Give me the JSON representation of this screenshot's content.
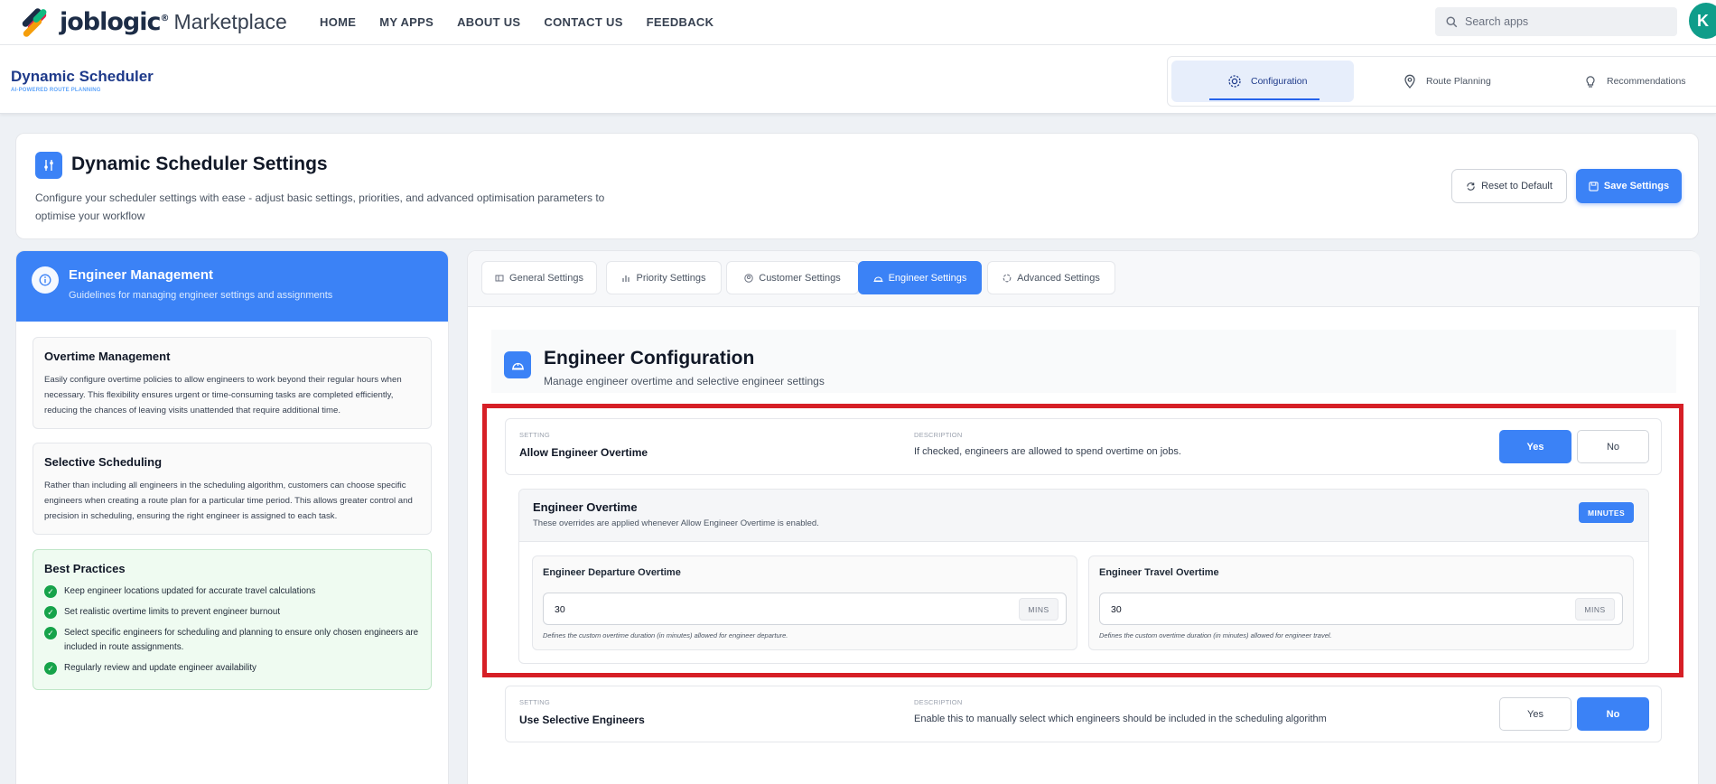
{
  "topnav": {
    "brand": "joblogic",
    "brand_mark": "®",
    "product": "Marketplace",
    "links": [
      "HOME",
      "MY APPS",
      "ABOUT US",
      "CONTACT US",
      "FEEDBACK"
    ],
    "search_placeholder": "Search apps",
    "avatar_initial": "K"
  },
  "app": {
    "title": "Dynamic Scheduler",
    "subtitle": "AI-POWERED ROUTE PLANNING",
    "tabs": [
      {
        "label": "Configuration",
        "icon": "gear-icon",
        "active": true
      },
      {
        "label": "Route Planning",
        "icon": "map-pin-icon",
        "active": false
      },
      {
        "label": "Recommendations",
        "icon": "lightbulb-icon",
        "active": false
      }
    ]
  },
  "settings_header": {
    "title": "Dynamic Scheduler Settings",
    "description": "Configure your scheduler settings with ease - adjust basic settings, priorities, and advanced optimisation parameters to optimise your workflow",
    "reset_label": "Reset to Default",
    "save_label": "Save Settings"
  },
  "left_panel": {
    "title": "Engineer Management",
    "subtitle": "Guidelines for managing engineer settings and assignments",
    "cards": [
      {
        "title": "Overtime Management",
        "text": "Easily configure overtime policies to allow engineers to work beyond their regular hours when necessary. This flexibility ensures urgent or time-consuming tasks are completed efficiently, reducing the chances of leaving visits unattended that require additional time."
      },
      {
        "title": "Selective Scheduling",
        "text": "Rather than including all engineers in the scheduling algorithm, customers can choose specific engineers when creating a route plan for a particular time period. This allows greater control and precision in scheduling, ensuring the right engineer is assigned to each task."
      }
    ],
    "best_practices": {
      "title": "Best Practices",
      "items": [
        "Keep engineer locations updated for accurate travel calculations",
        "Set realistic overtime limits to prevent engineer burnout",
        "Select specific engineers for scheduling and planning to ensure only chosen engineers are included in route assignments.",
        "Regularly review and update engineer availability"
      ]
    }
  },
  "tabs": [
    {
      "label": "General Settings",
      "active": false
    },
    {
      "label": "Priority Settings",
      "active": false
    },
    {
      "label": "Customer Settings",
      "active": false
    },
    {
      "label": "Engineer Settings",
      "active": true
    },
    {
      "label": "Advanced Settings",
      "active": false
    }
  ],
  "engineer_config": {
    "title": "Engineer Configuration",
    "subtitle": "Manage engineer overtime and selective engineer settings",
    "setting_label": "SETTING",
    "description_label": "DESCRIPTION",
    "yes_label": "Yes",
    "no_label": "No",
    "allow_overtime": {
      "name": "Allow Engineer Overtime",
      "description": "If checked, engineers are allowed to spend overtime on jobs.",
      "value": "Yes"
    },
    "overtime": {
      "title": "Engineer Overtime",
      "subtitle": "These overrides are applied whenever Allow Engineer Overtime is enabled.",
      "badge": "MINUTES",
      "departure": {
        "label": "Engineer Departure Overtime",
        "value": "30",
        "unit": "MINS",
        "help": "Defines the custom overtime duration (in minutes) allowed for engineer departure."
      },
      "travel": {
        "label": "Engineer Travel Overtime",
        "value": "30",
        "unit": "MINS",
        "help": "Defines the custom overtime duration (in minutes) allowed for engineer travel."
      }
    },
    "selective": {
      "name": "Use Selective Engineers",
      "description": "Enable this to manually select which engineers should be included in the scheduling algorithm",
      "value": "No"
    }
  },
  "colors": {
    "accent": "#3b82f6",
    "highlight": "#d61f26",
    "success": "#16a34a"
  }
}
